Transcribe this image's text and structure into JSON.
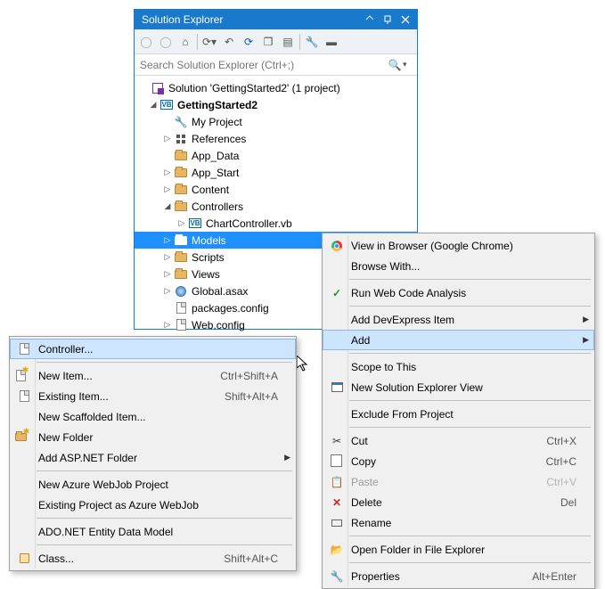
{
  "panel": {
    "title": "Solution Explorer",
    "search_placeholder": "Search Solution Explorer (Ctrl+;)"
  },
  "tree": {
    "solution": "Solution 'GettingStarted2' (1 project)",
    "project": "GettingStarted2",
    "my_project": "My Project",
    "references": "References",
    "app_data": "App_Data",
    "app_start": "App_Start",
    "content": "Content",
    "controllers": "Controllers",
    "chart_controller": "ChartController.vb",
    "models": "Models",
    "scripts": "Scripts",
    "views": "Views",
    "global_asax": "Global.asax",
    "packages_config": "packages.config",
    "web_config": "Web.config"
  },
  "ctx": {
    "view_browser": "View in Browser (Google Chrome)",
    "browse_with": "Browse With...",
    "run_web_code": "Run Web Code Analysis",
    "add_dx": "Add DevExpress Item",
    "add": "Add",
    "scope": "Scope to This",
    "new_view": "New Solution Explorer View",
    "exclude": "Exclude From Project",
    "cut": "Cut",
    "cut_sc": "Ctrl+X",
    "copy": "Copy",
    "copy_sc": "Ctrl+C",
    "paste": "Paste",
    "paste_sc": "Ctrl+V",
    "delete": "Delete",
    "delete_sc": "Del",
    "rename": "Rename",
    "open_folder": "Open Folder in File Explorer",
    "properties": "Properties",
    "properties_sc": "Alt+Enter"
  },
  "sub": {
    "controller": "Controller...",
    "new_item": "New Item...",
    "new_item_sc": "Ctrl+Shift+A",
    "existing_item": "Existing Item...",
    "existing_item_sc": "Shift+Alt+A",
    "new_scaffold": "New Scaffolded Item...",
    "new_folder": "New Folder",
    "asp_folder": "Add ASP.NET Folder",
    "webjob": "New Azure WebJob Project",
    "existing_webjob": "Existing Project as Azure WebJob",
    "ado": "ADO.NET Entity Data Model",
    "class": "Class...",
    "class_sc": "Shift+Alt+C"
  }
}
